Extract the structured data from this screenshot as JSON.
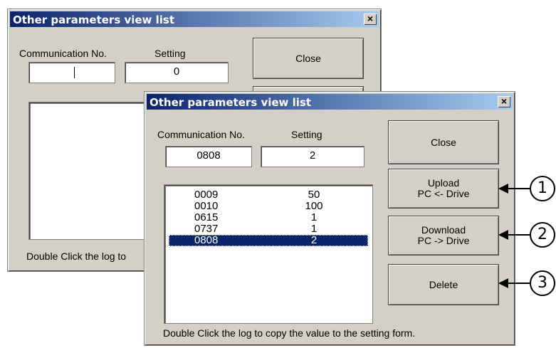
{
  "back_window": {
    "title": "Other parameters view list",
    "comm_label": "Communication No.",
    "setting_label": "Setting",
    "comm_value": "",
    "setting_value": "0",
    "close_label": "Close",
    "status_text": "Double Click the log to"
  },
  "front_window": {
    "title": "Other parameters view list",
    "comm_label": "Communication No.",
    "setting_label": "Setting",
    "comm_value": "0808",
    "setting_value": "2",
    "close_label": "Close",
    "upload_label_1": "Upload",
    "upload_label_2": "PC <- Drive",
    "download_label_1": "Download",
    "download_label_2": "PC -> Drive",
    "delete_label": "Delete",
    "status_text": "Double Click the log to copy the value to the setting form.",
    "rows": [
      {
        "no": "0009",
        "value": "50"
      },
      {
        "no": "0010",
        "value": "100"
      },
      {
        "no": "0615",
        "value": "1"
      },
      {
        "no": "0737",
        "value": "1"
      },
      {
        "no": "0808",
        "value": "2",
        "selected": true
      }
    ]
  },
  "callouts": [
    "1",
    "2",
    "3"
  ],
  "close_x": "×",
  "colors": {
    "titlebar_start": "#0a246a",
    "titlebar_end": "#a6caf0",
    "selection": "#0a246a",
    "face": "#d4d0c8"
  }
}
